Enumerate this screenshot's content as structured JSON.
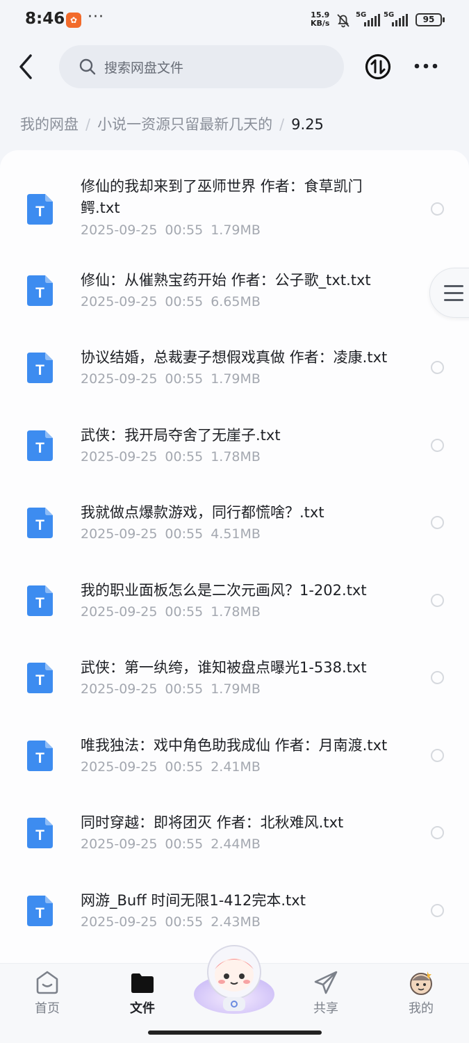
{
  "status_bar": {
    "time": "8:46",
    "net_speed_value": "15.9",
    "net_speed_unit": "KB/s",
    "signal_1": "5G",
    "signal_2": "5G",
    "battery": "95"
  },
  "header": {
    "search_placeholder": "搜索网盘文件"
  },
  "breadcrumb": {
    "root": "我的网盘",
    "parent": "小说一资源只留最新几天的",
    "current": "9.25",
    "separator": "/"
  },
  "files": [
    {
      "name": "修仙的我却来到了巫师世界 作者：食草凯门鳄.txt",
      "date": "2025-09-25",
      "time": "00:55",
      "size": "1.79MB"
    },
    {
      "name": "修仙：从催熟宝药开始 作者：公子歌_txt.txt",
      "date": "2025-09-25",
      "time": "00:55",
      "size": "6.65MB"
    },
    {
      "name": "协议结婚，总裁妻子想假戏真做 作者：凌康.txt",
      "date": "2025-09-25",
      "time": "00:55",
      "size": "1.79MB"
    },
    {
      "name": "武侠：我开局夺舍了无崖子.txt",
      "date": "2025-09-25",
      "time": "00:55",
      "size": "1.78MB"
    },
    {
      "name": "我就做点爆款游戏，同行都慌啥？.txt",
      "date": "2025-09-25",
      "time": "00:55",
      "size": "4.51MB"
    },
    {
      "name": "我的职业面板怎么是二次元画风？1-202.txt",
      "date": "2025-09-25",
      "time": "00:55",
      "size": "1.78MB"
    },
    {
      "name": "武侠：第一纨绔，谁知被盘点曝光1-538.txt",
      "date": "2025-09-25",
      "time": "00:55",
      "size": "1.79MB"
    },
    {
      "name": "唯我独法：戏中角色助我成仙 作者：月南渡.txt",
      "date": "2025-09-25",
      "time": "00:55",
      "size": "2.41MB"
    },
    {
      "name": "同时穿越：即将团灭 作者：北秋难风.txt",
      "date": "2025-09-25",
      "time": "00:55",
      "size": "2.44MB"
    },
    {
      "name": "网游_Buff 时间无限1-412完本.txt",
      "date": "2025-09-25",
      "time": "00:55",
      "size": "2.43MB"
    }
  ],
  "file_icon_letter": "T",
  "bottom_nav": {
    "home": "首页",
    "files": "文件",
    "share": "共享",
    "mine": "我的",
    "active": "files"
  },
  "colors": {
    "file_icon": "#3d8cf0",
    "background": "#f3f5f9",
    "card": "#fdfdfe"
  }
}
